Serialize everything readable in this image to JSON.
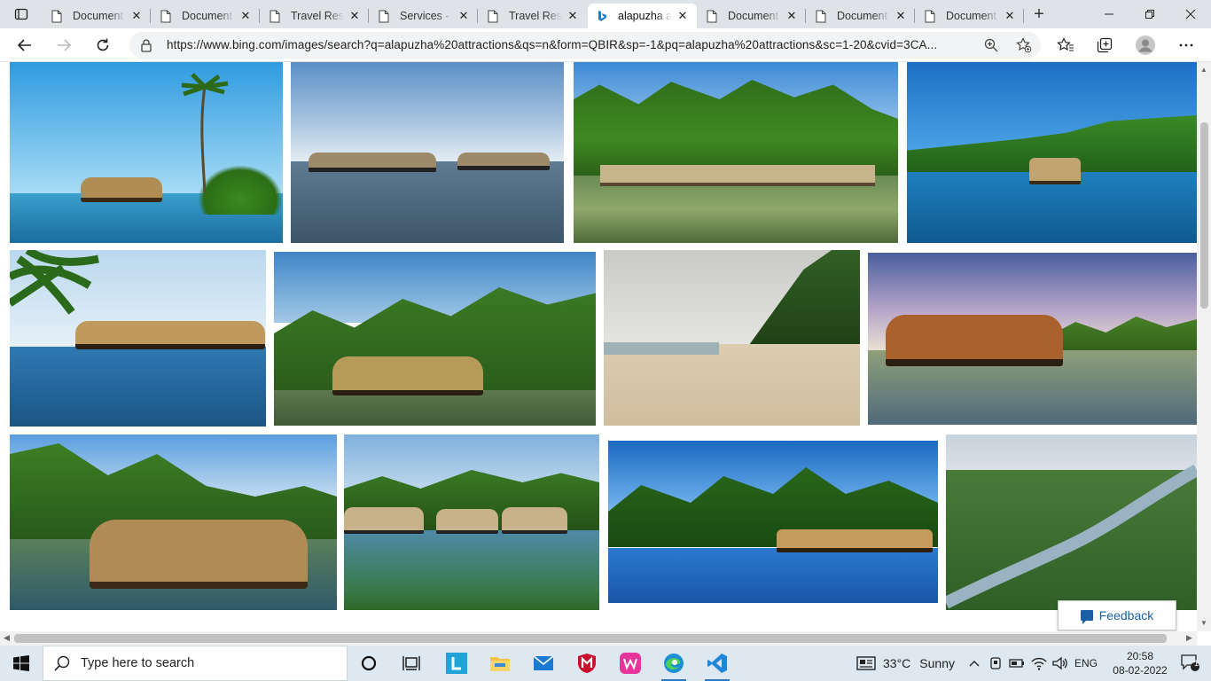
{
  "browser": {
    "tabs": [
      {
        "title": "Document",
        "icon": "page-icon",
        "active": false
      },
      {
        "title": "Document",
        "icon": "page-icon",
        "active": false
      },
      {
        "title": "Travel Resp",
        "icon": "page-icon",
        "active": false
      },
      {
        "title": "Services - T",
        "icon": "page-icon",
        "active": false
      },
      {
        "title": "Travel Resp",
        "icon": "page-icon",
        "active": false
      },
      {
        "title": "alapuzha a",
        "icon": "bing-icon",
        "active": true
      },
      {
        "title": "Document",
        "icon": "page-icon",
        "active": false
      },
      {
        "title": "Document",
        "icon": "page-icon",
        "active": false
      },
      {
        "title": "Document",
        "icon": "page-icon",
        "active": false
      }
    ],
    "url": "https://www.bing.com/images/search?q=alapuzha%20attractions&qs=n&form=QBIR&sp=-1&pq=alapuzha%20attractions&sc=1-20&cvid=3CA...",
    "new_tab_symbol": "+",
    "close_symbol": "✕"
  },
  "results": {
    "image_count": 12,
    "feedback_label": "Feedback"
  },
  "taskbar": {
    "search_placeholder": "Type here to search",
    "temperature": "33°C",
    "weather": "Sunny",
    "language": "ENG",
    "time": "20:58",
    "date": "08-02-2022",
    "notification_count": "1"
  },
  "colors": {
    "accent": "#0067b8",
    "tabstrip": "#dfe3e8",
    "taskbar": "#dde8f0",
    "feedback": "#1a5fa8"
  }
}
